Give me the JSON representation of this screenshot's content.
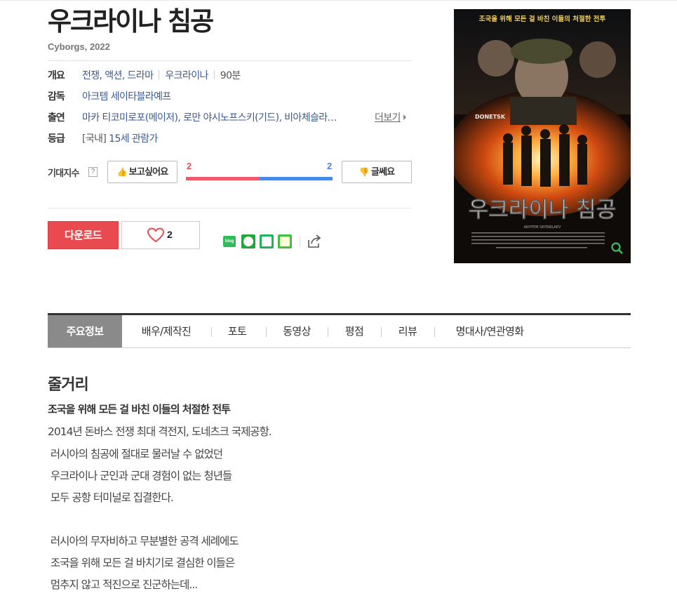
{
  "movie": {
    "title": "우크라이나 침공",
    "subtitle": "Cyborgs, 2022"
  },
  "info": {
    "overview_label": "개요",
    "genre": "전쟁, 액션, 드라마",
    "country": "우크라이나",
    "runtime": "90분",
    "director_label": "감독",
    "director": "아크템 세이타블라예프",
    "cast_label": "출연",
    "cast": "마카 티코미로포(메이저), 로만 야시노프스키(기드), 비아체슬라…",
    "more_label": "더보기",
    "rating_label": "등급",
    "rating_prefix": "[국내]",
    "rating": "15세 관람가"
  },
  "expectation": {
    "label": "기대지수",
    "help": "?",
    "like_label": "보고싶어요",
    "dislike_label": "글쎄요",
    "like_count": "2",
    "dislike_count": "2",
    "like_ratio": 0.5
  },
  "actions": {
    "download_label": "다운로드",
    "heart_count": "2",
    "blog_label": "blog"
  },
  "poster": {
    "tagline": "조국을 위해 모든 걸 바친 이들의 처절한 전투",
    "title": "우크라이나 침공",
    "sign": "DONETSK",
    "director_credit": "AKHTEM SEITABLAEV"
  },
  "tabs": [
    {
      "label": "주요정보"
    },
    {
      "label": "배우/제작진"
    },
    {
      "label": "포토"
    },
    {
      "label": "동영상"
    },
    {
      "label": "평점"
    },
    {
      "label": "리뷰"
    },
    {
      "label": "명대사/연관영화"
    }
  ],
  "synopsis": {
    "section_title": "줄거리",
    "headline": "조국을 위해 모든 걸 바친 이들의 처절한 전투",
    "lines": [
      "2014년 돈바스 전쟁 최대 격전지, 도네츠크 국제공항.",
      " 러시아의 침공에 절대로 물러날 수 없었던",
      " 우크라이나 군인과 군대 경험이 없는 청년들",
      " 모두 공항 터미널로 집결한다.",
      "",
      " 러시아의 무자비하고 무분별한 공격 세례에도",
      " 조국을 위해 모든 걸 바치기로 결심한 이들은",
      " 멈추지 않고 적진으로 진군하는데..."
    ]
  },
  "colors": {
    "accent_red": "#e94a4f",
    "like_red": "#f05a6a",
    "dislike_blue": "#4a88e8",
    "link_blue": "#3a5a90",
    "tab_active": "#8a8a8a"
  }
}
